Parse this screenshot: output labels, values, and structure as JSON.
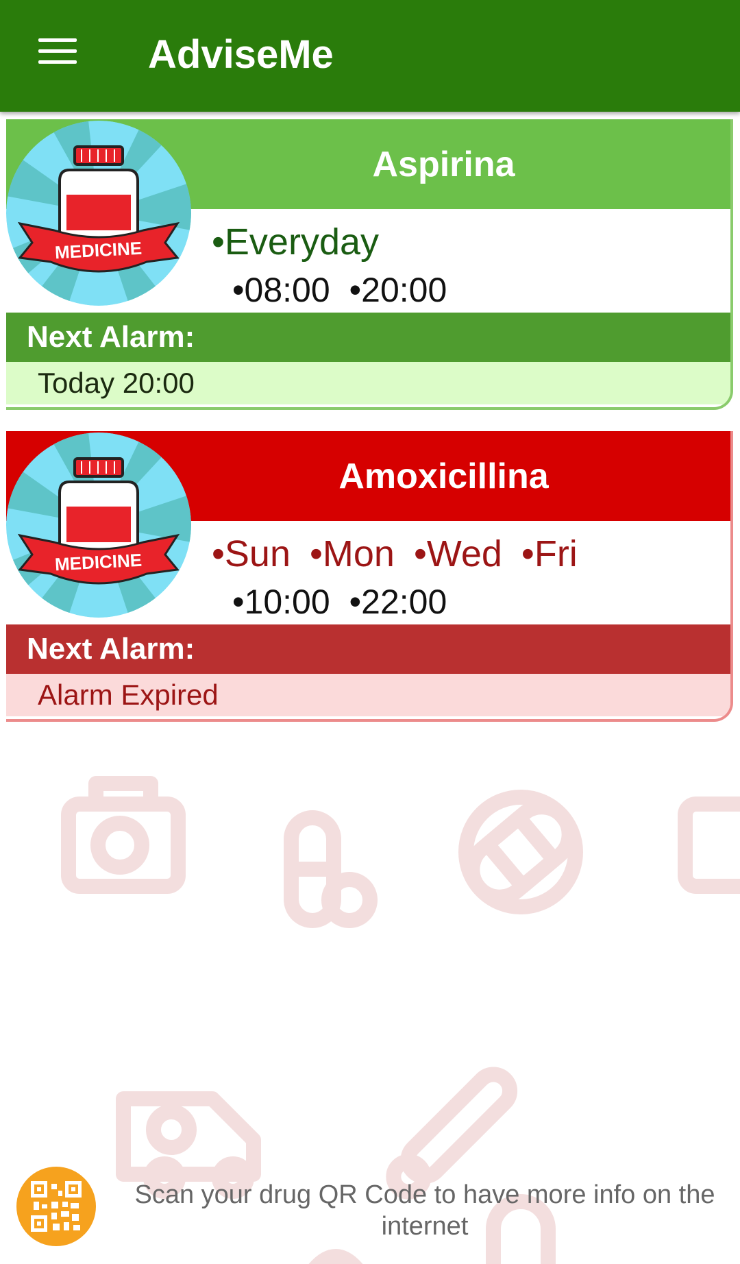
{
  "app_bar": {
    "title": "AdviseMe",
    "menu_icon": "hamburger-menu-icon",
    "color": "#2a7c0b"
  },
  "cards": [
    {
      "drug_name": "Aspirina",
      "days": [
        "•Everyday"
      ],
      "times": [
        "•08:00",
        "•20:00"
      ],
      "next_alarm_label": "Next Alarm:",
      "next_alarm_value": "Today 20:00",
      "badge_text": "MEDICINE",
      "colors": {
        "header": "#6cc04a",
        "next_head": "#4f9c2f",
        "next_bg": "#dcfcc8",
        "days_text": "#1a5c12",
        "border": "#8acb6c"
      }
    },
    {
      "drug_name": "Amoxicillina",
      "days": [
        "•Sun",
        "•Mon",
        "•Wed",
        "•Fri"
      ],
      "times": [
        "•10:00",
        "•22:00"
      ],
      "next_alarm_label": "Next Alarm:",
      "next_alarm_value": "Alarm Expired",
      "badge_text": "MEDICINE",
      "colors": {
        "header": "#d60000",
        "next_head": "#b93030",
        "next_bg": "#fbdada",
        "days_text": "#9c1515",
        "border": "#ec8b8b"
      }
    }
  ],
  "bottom": {
    "scan_text": "Scan your drug QR Code to have more info on the internet",
    "qr_icon": "qr-code-icon",
    "qr_color": "#f6a21e"
  }
}
